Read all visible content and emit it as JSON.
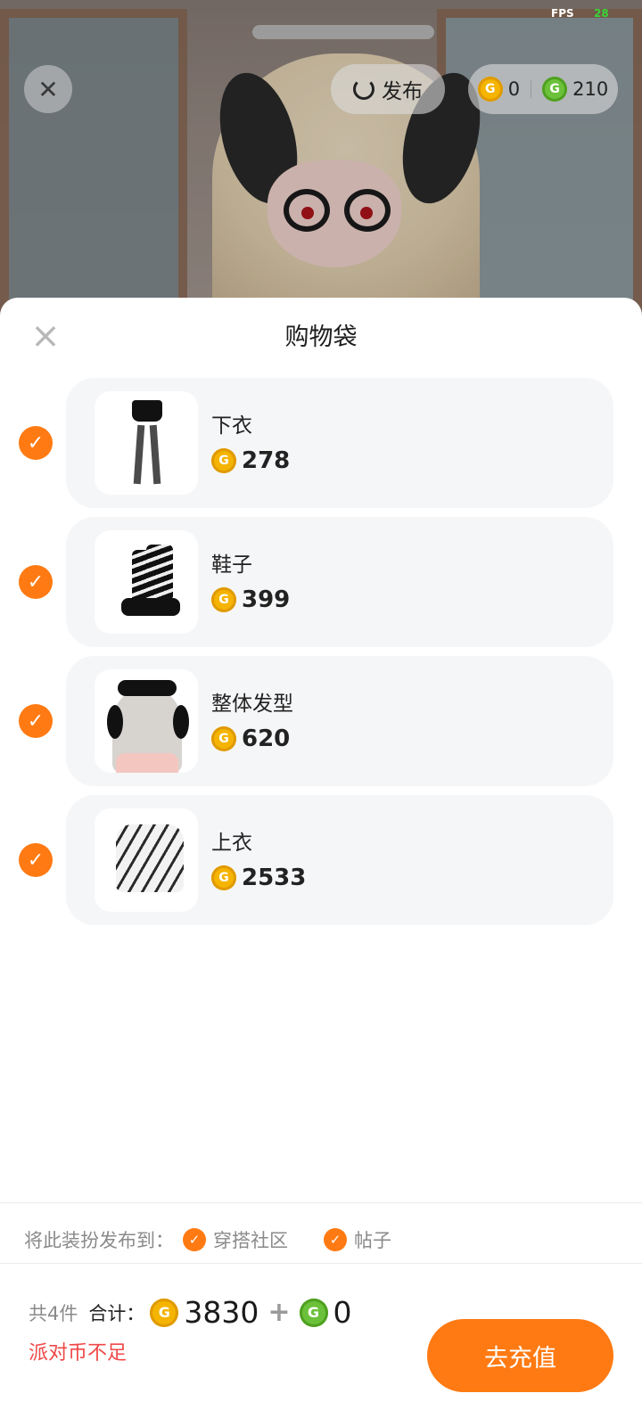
{
  "status": {
    "fps_label": "FPS",
    "fps_value": "28"
  },
  "topbar": {
    "close_icon": "close-icon",
    "publish_label": "发布",
    "gold_balance": "0",
    "green_balance": "210",
    "coin_glyph": "G"
  },
  "sheet": {
    "title": "购物袋",
    "close_glyph": "×",
    "items": [
      {
        "name": "下衣",
        "price": "278"
      },
      {
        "name": "鞋子",
        "price": "399"
      },
      {
        "name": "整体发型",
        "price": "620"
      },
      {
        "name": "上衣",
        "price": "2533"
      }
    ]
  },
  "publish_to": {
    "label": "将此装扮发布到：",
    "options": [
      "穿搭社区",
      "帖子"
    ]
  },
  "footer": {
    "count_text": "共4件",
    "total_label": "合计：",
    "gold_total": "3830",
    "plus": "+",
    "green_total": "0",
    "warning": "派对币不足",
    "recharge_label": "去充值"
  },
  "colors": {
    "accent": "#ff7a12",
    "warning": "#f04848",
    "card_bg": "#f5f6f8",
    "gold": "#f5b400",
    "green": "#6cc13a"
  }
}
